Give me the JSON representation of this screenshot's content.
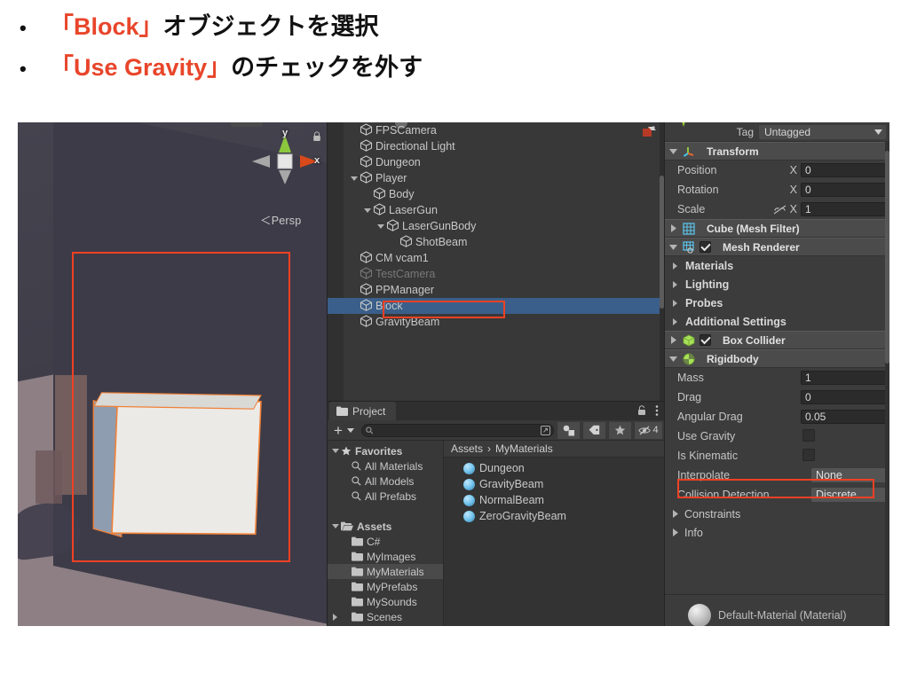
{
  "slide": {
    "bullets": [
      {
        "mark": "•",
        "highlight": "「Block」",
        "rest": "オブジェクトを選択"
      },
      {
        "mark": "•",
        "highlight": "「Use Gravity」",
        "rest": "のチェックを外す"
      }
    ],
    "accent_color": "#e8452a"
  },
  "scene_view": {
    "gizmo": {
      "y_label": "y",
      "x_label": "x"
    },
    "projection_label": "＜Persp",
    "annotation_color": "#ef4124"
  },
  "hierarchy": {
    "items": [
      {
        "label": "FPSCamera",
        "depth": 1,
        "arrow": "none",
        "state": "normal"
      },
      {
        "label": "Directional Light",
        "depth": 1,
        "arrow": "none",
        "state": "normal"
      },
      {
        "label": "Dungeon",
        "depth": 1,
        "arrow": "none",
        "state": "normal"
      },
      {
        "label": "Player",
        "depth": 1,
        "arrow": "down",
        "state": "normal"
      },
      {
        "label": "Body",
        "depth": 2,
        "arrow": "none",
        "state": "normal"
      },
      {
        "label": "LaserGun",
        "depth": 2,
        "arrow": "down",
        "state": "normal"
      },
      {
        "label": "LaserGunBody",
        "depth": 3,
        "arrow": "down",
        "state": "normal"
      },
      {
        "label": "ShotBeam",
        "depth": 4,
        "arrow": "none",
        "state": "normal"
      },
      {
        "label": "CM vcam1",
        "depth": 1,
        "arrow": "none",
        "state": "normal"
      },
      {
        "label": "TestCamera",
        "depth": 1,
        "arrow": "none",
        "state": "disabled"
      },
      {
        "label": "PPManager",
        "depth": 1,
        "arrow": "none",
        "state": "normal"
      },
      {
        "label": "Block",
        "depth": 1,
        "arrow": "none",
        "state": "selected"
      },
      {
        "label": "GravityBeam",
        "depth": 1,
        "arrow": "none",
        "state": "normal"
      }
    ],
    "selected_label": "Block",
    "selection_color": "#3a5f8a"
  },
  "project": {
    "tab_label": "Project",
    "search_placeholder": "",
    "hidden_count": "4",
    "breadcrumb": [
      "Assets",
      "MyMaterials"
    ],
    "tree": [
      {
        "label": "Favorites",
        "depth": 0,
        "icon": "star-icon",
        "arrow": "down",
        "highlight": false
      },
      {
        "label": "All Materials",
        "depth": 1,
        "icon": "search-icon",
        "arrow": "none",
        "highlight": false
      },
      {
        "label": "All Models",
        "depth": 1,
        "icon": "search-icon",
        "arrow": "none",
        "highlight": false
      },
      {
        "label": "All Prefabs",
        "depth": 1,
        "icon": "search-icon",
        "arrow": "none",
        "highlight": false
      },
      {
        "label": "",
        "depth": 0,
        "icon": "none",
        "arrow": "none",
        "highlight": false
      },
      {
        "label": "Assets",
        "depth": 0,
        "icon": "folder-open-icon",
        "arrow": "down",
        "highlight": false
      },
      {
        "label": "C#",
        "depth": 1,
        "icon": "folder-icon",
        "arrow": "none",
        "highlight": false
      },
      {
        "label": "MyImages",
        "depth": 1,
        "icon": "folder-icon",
        "arrow": "none",
        "highlight": false
      },
      {
        "label": "MyMaterials",
        "depth": 1,
        "icon": "folder-icon",
        "arrow": "none",
        "highlight": true
      },
      {
        "label": "MyPrefabs",
        "depth": 1,
        "icon": "folder-icon",
        "arrow": "none",
        "highlight": false
      },
      {
        "label": "MySounds",
        "depth": 1,
        "icon": "folder-icon",
        "arrow": "none",
        "highlight": false
      },
      {
        "label": "Scenes",
        "depth": 1,
        "icon": "folder-icon",
        "arrow": "right",
        "highlight": false
      }
    ],
    "assets": [
      {
        "label": "Dungeon",
        "icon": "material-icon"
      },
      {
        "label": "GravityBeam",
        "icon": "material-icon"
      },
      {
        "label": "NormalBeam",
        "icon": "material-icon"
      },
      {
        "label": "ZeroGravityBeam",
        "icon": "material-icon"
      }
    ]
  },
  "inspector": {
    "tag_label": "Tag",
    "tag_value": "Untagged",
    "components": [
      {
        "name": "Transform",
        "fold": "down",
        "checkbox": "none",
        "icon": "transform-icon"
      },
      {
        "name": "Cube (Mesh Filter)",
        "fold": "right",
        "checkbox": "none",
        "icon": "mesh-filter-icon"
      },
      {
        "name": "Mesh Renderer",
        "fold": "down",
        "checkbox": "on",
        "icon": "mesh-renderer-icon"
      },
      {
        "name": "Box Collider",
        "fold": "right",
        "checkbox": "on",
        "icon": "box-collider-icon"
      },
      {
        "name": "Rigidbody",
        "fold": "down",
        "checkbox": "none",
        "icon": "rigidbody-icon"
      }
    ],
    "transform": [
      {
        "label": "Position",
        "axis": "X",
        "value": "0",
        "link": false
      },
      {
        "label": "Rotation",
        "axis": "X",
        "value": "0",
        "link": false
      },
      {
        "label": "Scale",
        "axis": "X",
        "value": "1",
        "link": true
      }
    ],
    "mesh_renderer_sections": [
      "Materials",
      "Lighting",
      "Probes",
      "Additional Settings"
    ],
    "rigidbody": {
      "mass_label": "Mass",
      "mass_value": "1",
      "drag_label": "Drag",
      "drag_value": "0",
      "angular_drag_label": "Angular Drag",
      "angular_drag_value": "0.05",
      "use_gravity_label": "Use Gravity",
      "use_gravity_checked": false,
      "is_kinematic_label": "Is Kinematic",
      "is_kinematic_checked": false,
      "interpolate_label": "Interpolate",
      "interpolate_value": "None",
      "collision_detection_label": "Collision Detection",
      "collision_detection_value": "Discrete",
      "constraints_label": "Constraints",
      "info_label": "Info"
    },
    "material_footer": "Default-Material (Material)",
    "annotation_color": "#ef4124"
  }
}
